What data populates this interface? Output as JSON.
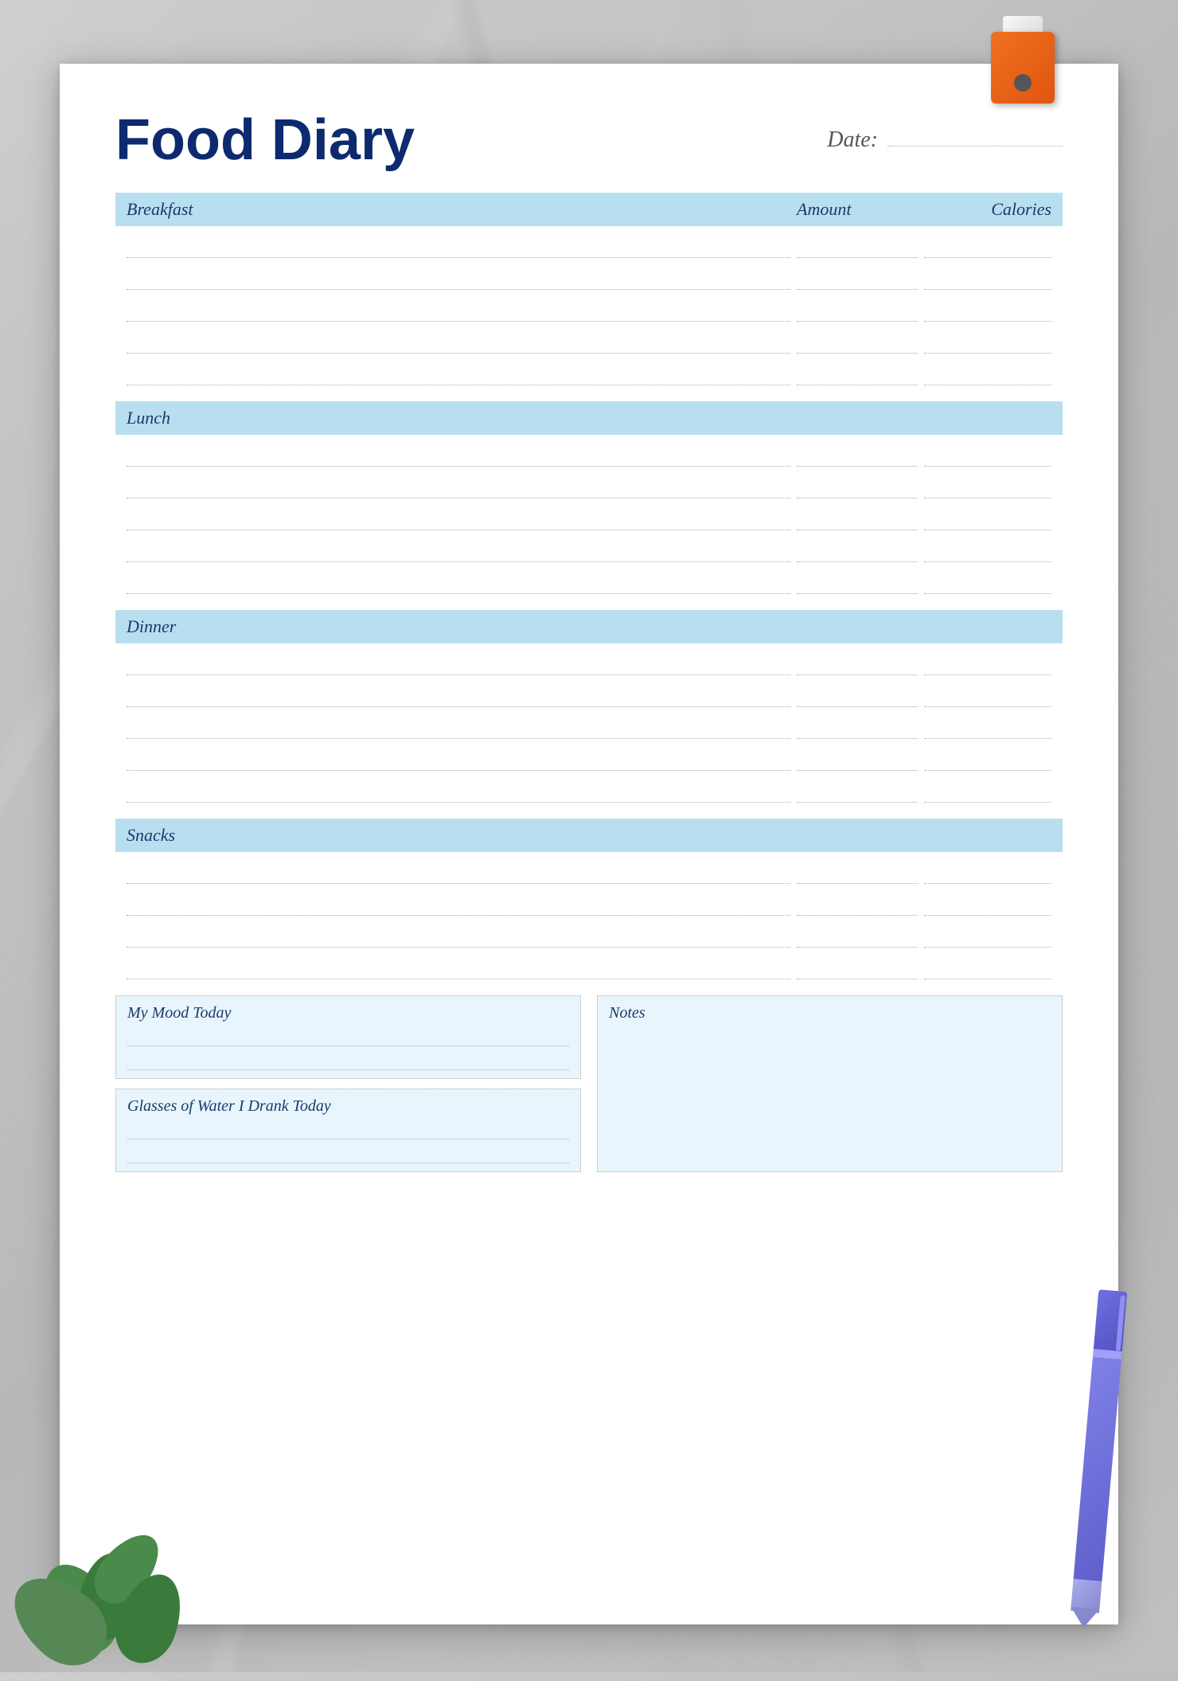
{
  "title": "Food Diary",
  "date_label": "Date:",
  "sections": [
    {
      "id": "breakfast",
      "label": "Breakfast",
      "col_amount": "Amount",
      "col_calories": "Calories",
      "rows": 5
    },
    {
      "id": "lunch",
      "label": "Lunch",
      "rows": 5
    },
    {
      "id": "dinner",
      "label": "Dinner",
      "rows": 5
    },
    {
      "id": "snacks",
      "label": "Snacks",
      "rows": 4
    }
  ],
  "bottom": {
    "mood_label": "My Mood Today",
    "water_label": "Glasses of Water I Drank Today",
    "notes_label": "Notes"
  }
}
